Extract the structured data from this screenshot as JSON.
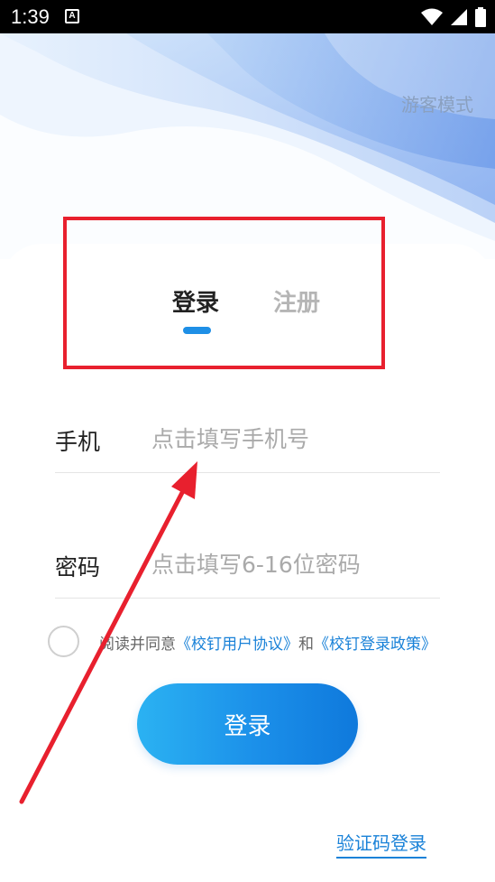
{
  "status_bar": {
    "time": "1:39",
    "notification_letter": "A",
    "icons": [
      "wifi-icon",
      "signal-icon",
      "battery-icon"
    ]
  },
  "header": {
    "guest_mode": "游客模式"
  },
  "tabs": {
    "login": "登录",
    "register": "注册",
    "active": "login"
  },
  "form": {
    "phone": {
      "label": "手机",
      "placeholder": "点击填写手机号",
      "value": ""
    },
    "password": {
      "label": "密码",
      "placeholder": "点击填写6-16位密码",
      "value": ""
    }
  },
  "agreement": {
    "checked": false,
    "prefix": "阅读并同意",
    "user_agreement": "《校钉用户协议》",
    "conjunction": "和",
    "login_policy": "《校钉登录政策》"
  },
  "login_button": "登录",
  "sms_login": "验证码登录",
  "colors": {
    "accent": "#1e8fe6",
    "link": "#1a82d8",
    "annotation_red": "#e8202e",
    "tab_inactive": "#b5b5b5"
  }
}
